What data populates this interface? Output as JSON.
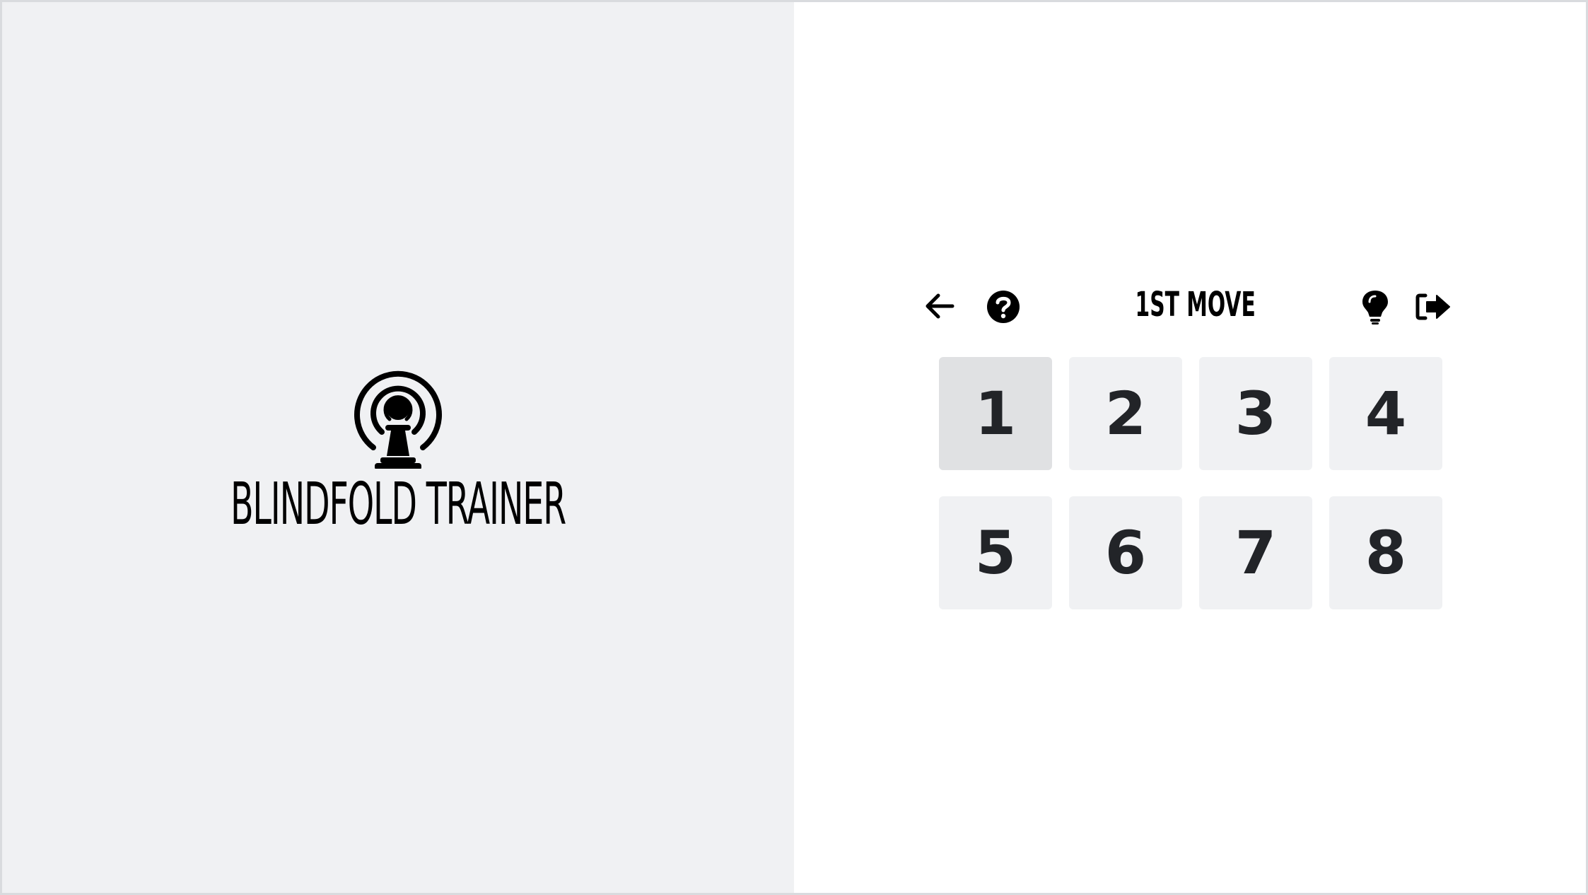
{
  "app": {
    "title": "BLINDFOLD TRAINER",
    "logo_icon": "broadcast-pawn-icon"
  },
  "toolbar": {
    "back_icon": "arrow-left-icon",
    "help_icon": "question-circle-icon",
    "title": "1ST MOVE",
    "hint_icon": "lightbulb-icon",
    "exit_icon": "sign-out-icon"
  },
  "number_buttons": [
    {
      "label": "1",
      "selected": true
    },
    {
      "label": "2",
      "selected": false
    },
    {
      "label": "3",
      "selected": false
    },
    {
      "label": "4",
      "selected": false
    },
    {
      "label": "5",
      "selected": false
    },
    {
      "label": "6",
      "selected": false
    },
    {
      "label": "7",
      "selected": false
    },
    {
      "label": "8",
      "selected": false
    }
  ],
  "colors": {
    "left_panel_bg": "#f0f1f3",
    "button_bg": "#f0f1f3",
    "button_selected_bg": "#e0e1e3",
    "text": "#222428"
  }
}
